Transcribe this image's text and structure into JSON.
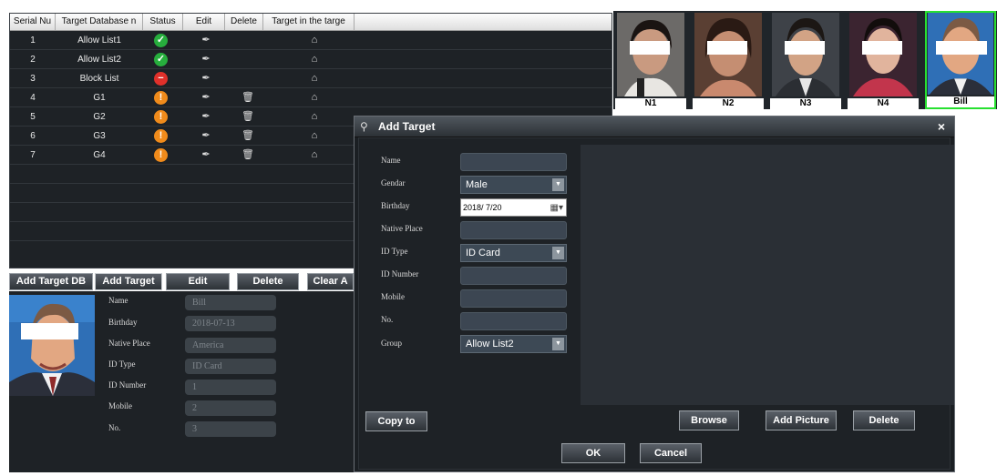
{
  "list": {
    "columns": [
      "Serial Nu",
      "Target Database n",
      "Status",
      "Edit",
      "Delete",
      "Target in the targe"
    ],
    "rows": [
      {
        "serial": "1",
        "name": "Allow List1",
        "status": "ok",
        "has_delete": false
      },
      {
        "serial": "2",
        "name": "Allow List2",
        "status": "ok",
        "has_delete": false
      },
      {
        "serial": "3",
        "name": "Block List",
        "status": "blocked",
        "has_delete": false
      },
      {
        "serial": "4",
        "name": "G1",
        "status": "warning",
        "has_delete": true
      },
      {
        "serial": "5",
        "name": "G2",
        "status": "warning",
        "has_delete": true
      },
      {
        "serial": "6",
        "name": "G3",
        "status": "warning",
        "has_delete": true
      },
      {
        "serial": "7",
        "name": "G4",
        "status": "warning",
        "has_delete": true
      }
    ],
    "icons": {
      "status_ok": "check-circle-icon",
      "status_blocked": "minus-circle-icon",
      "status_warning": "exclamation-circle-icon",
      "edit": "pencil-icon",
      "delete": "trash-icon",
      "target": "home-icon"
    }
  },
  "toolbar": {
    "add_target_db": "Add Target DB",
    "add_target": "Add Target",
    "edit": "Edit",
    "delete": "Delete",
    "clear_all": "Clear A"
  },
  "detail": {
    "labels": {
      "name": "Name",
      "birthday": "Birthday",
      "native_place": "Native Place",
      "id_type": "ID Type",
      "id_number": "ID Number",
      "mobile": "Mobile",
      "no": "No."
    },
    "values": {
      "name": "Bill",
      "birthday": "2018-07-13",
      "native_place": "America",
      "id_type": "ID Card",
      "id_number": "1",
      "mobile": "2",
      "no": "3"
    }
  },
  "thumbnails": [
    {
      "label": "N1",
      "selected": false
    },
    {
      "label": "N2",
      "selected": false
    },
    {
      "label": "N3",
      "selected": false
    },
    {
      "label": "N4",
      "selected": false
    },
    {
      "label": "Bill",
      "selected": true
    }
  ],
  "dialog": {
    "title": "Add Target",
    "close_glyph": "×",
    "labels": {
      "name": "Name",
      "gender": "Gendar",
      "birthday": "Birthday",
      "native_place": "Native Place",
      "id_type": "ID Type",
      "id_number": "ID Number",
      "mobile": "Mobile",
      "no": "No.",
      "group": "Group"
    },
    "values": {
      "name": "",
      "gender": "Male",
      "birthday": "2018/  7/20",
      "native_place": "",
      "id_type": "ID Card",
      "id_number": "",
      "mobile": "",
      "no": "",
      "group": "Allow List2"
    },
    "buttons": {
      "copy_to": "Copy to",
      "browse": "Browse",
      "add_picture": "Add Picture",
      "delete": "Delete",
      "ok": "OK",
      "cancel": "Cancel"
    }
  },
  "colors": {
    "ok": "#27ae3d",
    "blocked": "#e0302a",
    "warning": "#f08b1b",
    "selected_border": "#27e030"
  }
}
